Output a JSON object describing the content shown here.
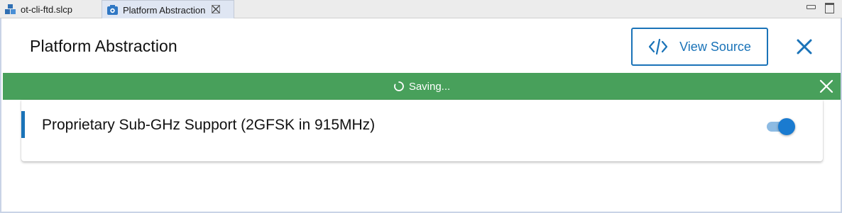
{
  "tabs": [
    {
      "label": "ot-cli-ftd.slcp",
      "icon": "project-cubes-icon"
    },
    {
      "label": "Platform Abstraction",
      "icon": "component-icon",
      "close": "✕"
    }
  ],
  "header": {
    "title": "Platform Abstraction",
    "view_source_label": "View Source"
  },
  "banner": {
    "status": "Saving...",
    "color": "#48a05b"
  },
  "component": {
    "title": "Proprietary Sub-GHz Support (2GFSK in 915MHz)",
    "enabled": true
  },
  "colors": {
    "accent": "#1a73b8",
    "toggle_on": "#1a7bd0"
  }
}
